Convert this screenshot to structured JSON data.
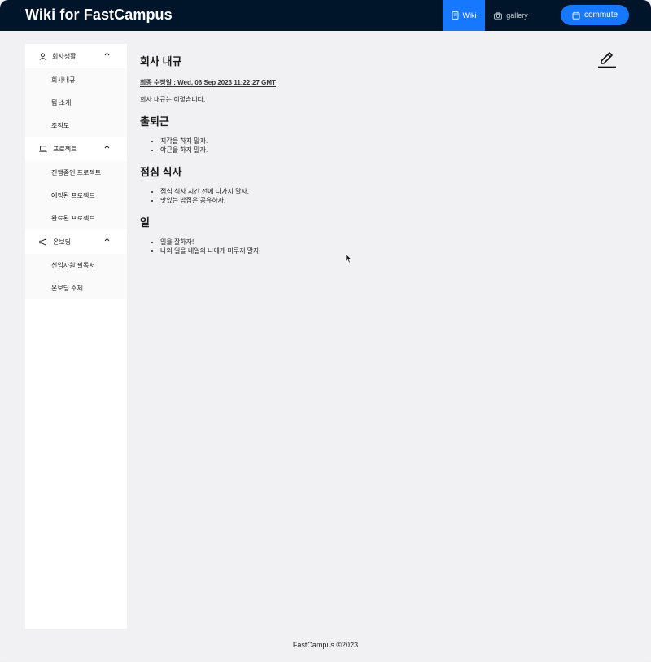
{
  "header": {
    "brand": "Wiki for FastCampus",
    "nav": [
      {
        "label": "Wiki",
        "icon": "book-icon",
        "active": true
      },
      {
        "label": "gallery",
        "icon": "camera-icon",
        "active": false
      }
    ],
    "commute_label": "commute"
  },
  "sidebar": {
    "groups": [
      {
        "label": "회사생활",
        "icon": "user-icon",
        "items": [
          "회사내규",
          "팀 소개",
          "조직도"
        ]
      },
      {
        "label": "프로젝트",
        "icon": "laptop-icon",
        "items": [
          "진행중인 프로젝트",
          "예정된 프로젝트",
          "완료된 프로젝트"
        ]
      },
      {
        "label": "온보딩",
        "icon": "megaphone-icon",
        "items": [
          "신입사원 필독서",
          "온보딩 주제"
        ]
      }
    ]
  },
  "main": {
    "title": "회사 내규",
    "modified": "최종 수정일 : Wed, 06 Sep 2023 11:22:27 GMT",
    "intro": "회사 내규는 이렇습니다.",
    "sections": [
      {
        "title": "출퇴근",
        "bullets": [
          "지각을 하지 말자.",
          "야근을 하지 말자."
        ]
      },
      {
        "title": "점심 식사",
        "bullets": [
          "점심 식사 시간 전에 나가지 말자.",
          "맛있는 밥집은 공유하자."
        ]
      },
      {
        "title": "일",
        "bullets": [
          "일을 잘하자!",
          "나의 일을 내일의 나에게 미루지 말자!"
        ]
      }
    ]
  },
  "footer": "FastCampus ©2023",
  "colors": {
    "header_bg": "#001529",
    "accent": "#1677ff",
    "page_bg": "#f1f1f3"
  }
}
